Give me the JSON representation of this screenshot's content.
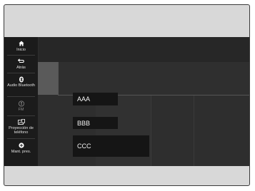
{
  "sidebar": {
    "items": [
      {
        "label": "Inicio",
        "icon": "home-icon"
      },
      {
        "label": "Atrás",
        "icon": "back-icon"
      },
      {
        "label": "Audio Bluetooth",
        "icon": "bluetooth-icon"
      },
      {
        "label": "FM",
        "icon": "fm-icon"
      },
      {
        "label": "Proyección de teléfono",
        "icon": "phone-projection-icon"
      },
      {
        "label": "Mant. pres.",
        "icon": "add-preset-icon"
      }
    ]
  },
  "list": {
    "items": [
      "AAA",
      "BBB",
      "CCC"
    ]
  },
  "colors": {
    "screen_background": "#2c2c2c",
    "sidebar_background": "#1b1b1b",
    "list_item_background": "#151515",
    "text": "#f2f2f2"
  }
}
